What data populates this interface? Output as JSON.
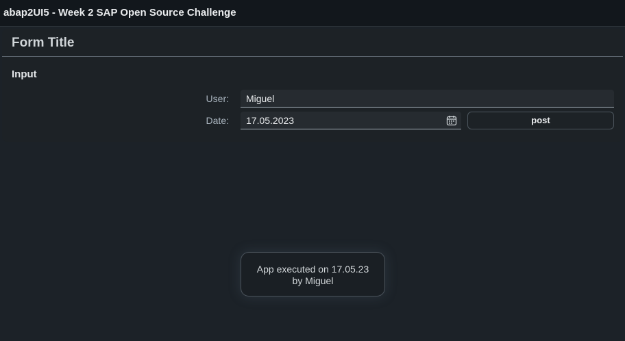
{
  "app": {
    "title": "abap2UI5 - Week 2 SAP Open Source Challenge"
  },
  "form": {
    "title": "Form Title",
    "section_title": "Input",
    "user_label": "User:",
    "user_value": "Miguel",
    "date_label": "Date:",
    "date_value": "17.05.2023",
    "date_icon": "calendar-icon",
    "post_label": "post"
  },
  "toast": {
    "line1": "App executed on 17.05.23",
    "line2": "by Miguel"
  },
  "colors": {
    "background": "#1c2228",
    "header": "#12171c",
    "panel": "#1d2226",
    "input": "#262b30",
    "text": "#eaecee",
    "label": "#a9b4be"
  }
}
